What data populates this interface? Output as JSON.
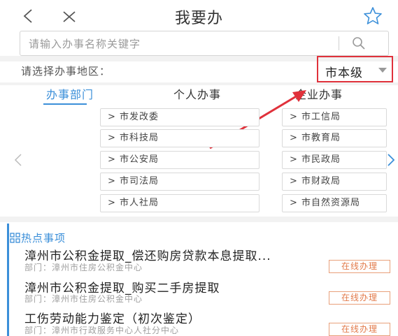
{
  "header": {
    "title": "我要办",
    "back_icon": "chevron-left-icon",
    "close_icon": "close-icon",
    "favorite_icon": "star-icon"
  },
  "search": {
    "placeholder": "请输入办事名称关键字",
    "icon": "search-icon"
  },
  "region": {
    "label": "请选择办事地区：",
    "value": "市本级"
  },
  "tabs": [
    {
      "label": "办事部门",
      "active": true
    },
    {
      "label": "个人办事",
      "active": false
    },
    {
      "label": "企业办事",
      "active": false
    }
  ],
  "departments": [
    "> 市发改委",
    "> 市工信局",
    "> 市科技局",
    "> 市教育局",
    "> 市公安局",
    "> 市民政局",
    "> 市司法局",
    "> 市财政局",
    "> 市人社局",
    "> 市自然资源局"
  ],
  "hot": {
    "heading": "热点事项",
    "items": [
      {
        "title": "漳州市公积金提取_偿还购房贷款本息提取...",
        "dept": "部门：漳州市住房公积金中心",
        "action": "在线办理"
      },
      {
        "title": "漳州市公积金提取_购买二手房提取",
        "dept": "部门：漳州市住房公积金中心",
        "action": "在线办理"
      },
      {
        "title": "工伤劳动能力鉴定（初次鉴定）",
        "dept": "部门：漳州市行政服务中心人社分中心",
        "action": "在线办理"
      }
    ]
  },
  "colors": {
    "accent": "#3b8fd9",
    "highlight": "#e0313b",
    "action": "#e27a4a"
  }
}
